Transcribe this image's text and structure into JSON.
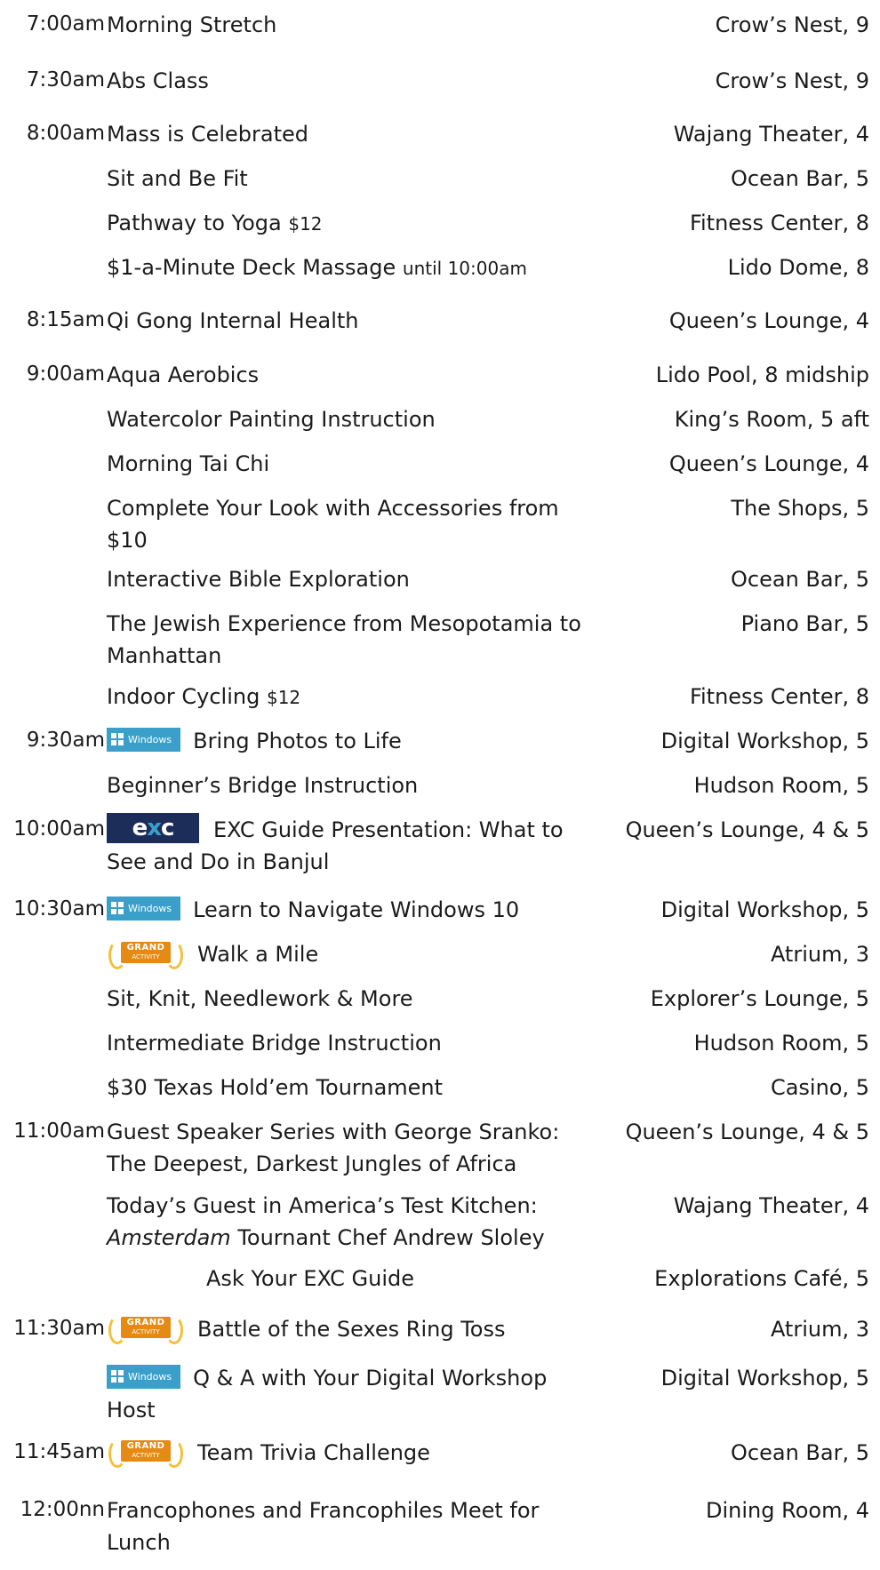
{
  "rows": [
    {
      "time": "7:00am",
      "title": "Morning Stretch",
      "loc": "Crow’s Nest, 9"
    },
    {
      "time": "7:30am",
      "title": "Abs Class",
      "loc": "Crow’s Nest, 9"
    },
    {
      "time": "8:00am",
      "title": "Mass is Celebrated",
      "loc": "Wajang Theater, 4"
    },
    {
      "title": "Sit and Be Fit",
      "loc": "Ocean Bar, 5"
    },
    {
      "title": "Pathway to Yoga",
      "price": "$12",
      "loc": "Fitness Center, 8"
    },
    {
      "title": "$1-a-Minute Deck Massage",
      "note": "until 10:00am",
      "loc": "Lido Dome, 8"
    },
    {
      "time": "8:15am",
      "title": "Qi Gong Internal Health",
      "loc": "Queen’s Lounge, 4"
    },
    {
      "time": "9:00am",
      "title": "Aqua Aerobics",
      "loc": "Lido Pool, 8 midship"
    },
    {
      "title": "Watercolor Painting Instruction",
      "loc": "King’s Room, 5 aft"
    },
    {
      "title": "Morning Tai Chi",
      "loc": "Queen’s Lounge, 4"
    },
    {
      "title": "Complete Your Look with Accessories from $10",
      "loc": "The Shops, 5"
    },
    {
      "title": "Interactive Bible Exploration",
      "loc": "Ocean Bar, 5"
    },
    {
      "title": "The Jewish Experience from Mesopotamia to Manhattan",
      "loc": "Piano Bar, 5"
    },
    {
      "title": "Indoor Cycling",
      "price": "$12",
      "loc": "Fitness Center, 8"
    },
    {
      "time": "9:30am",
      "badge": "Windows",
      "title": "Bring Photos to Life",
      "loc": "Digital Workshop, 5"
    },
    {
      "title": "Beginner’s Bridge Instruction",
      "loc": "Hudson Room, 5"
    },
    {
      "time": "10:00am",
      "badge": "exc",
      "title": "EXC Guide Presentation: What to See and Do in  Banjul",
      "loc": "Queen’s Lounge, 4 & 5"
    },
    {
      "time": "10:30am",
      "badge": "Windows",
      "title": "Learn to Navigate Windows 10",
      "loc": "Digital Workshop, 5"
    },
    {
      "badge": "grand",
      "title": "Walk a Mile",
      "loc": "Atrium, 3"
    },
    {
      "title": "Sit, Knit, Needlework & More",
      "loc": "Explorer’s Lounge, 5"
    },
    {
      "title": "Intermediate Bridge Instruction",
      "loc": "Hudson Room, 5"
    },
    {
      "title": "$30 Texas Hold’em Tournament",
      "loc": "Casino, 5"
    },
    {
      "time": "11:00am",
      "title": "Guest Speaker Series with George Sranko: The Deepest, Darkest Jungles of Africa",
      "loc": "Queen’s Lounge, 4 & 5"
    },
    {
      "title_prefix": "Today’s Guest in America’s Test Kitchen:",
      "title_italic": "Amsterdam",
      "title": "Tournant Chef Andrew Sloley",
      "loc": "Wajang Theater, 4"
    },
    {
      "title": "Ask Your EXC Guide",
      "indent": true,
      "loc": "Explorations Café, 5"
    },
    {
      "time": "11:30am",
      "badge": "grand",
      "title": "Battle of the Sexes Ring Toss",
      "loc": "Atrium, 3"
    },
    {
      "badge": "Windows",
      "title": "Q & A with Your Digital Workshop Host",
      "loc": "Digital Workshop, 5"
    },
    {
      "time": "11:45am",
      "badge": "grand",
      "title": "Team Trivia Challenge",
      "loc": "Ocean Bar, 5"
    },
    {
      "time": "12:00nn",
      "title": "Francophones and Francophiles Meet for Lunch",
      "loc": "Dining Room, 4"
    }
  ],
  "badges": {
    "windows_label": "Windows",
    "exc_label": "exc",
    "grand_line1": "GRAND",
    "grand_line2": "ACTIVITY"
  },
  "colors": {
    "text": "#1b1b1b",
    "windows_badge": "#3aa0c9",
    "exc_badge": "#1d2d5a",
    "grand_badge": "#e58a12",
    "laurel": "#f2c13a"
  }
}
